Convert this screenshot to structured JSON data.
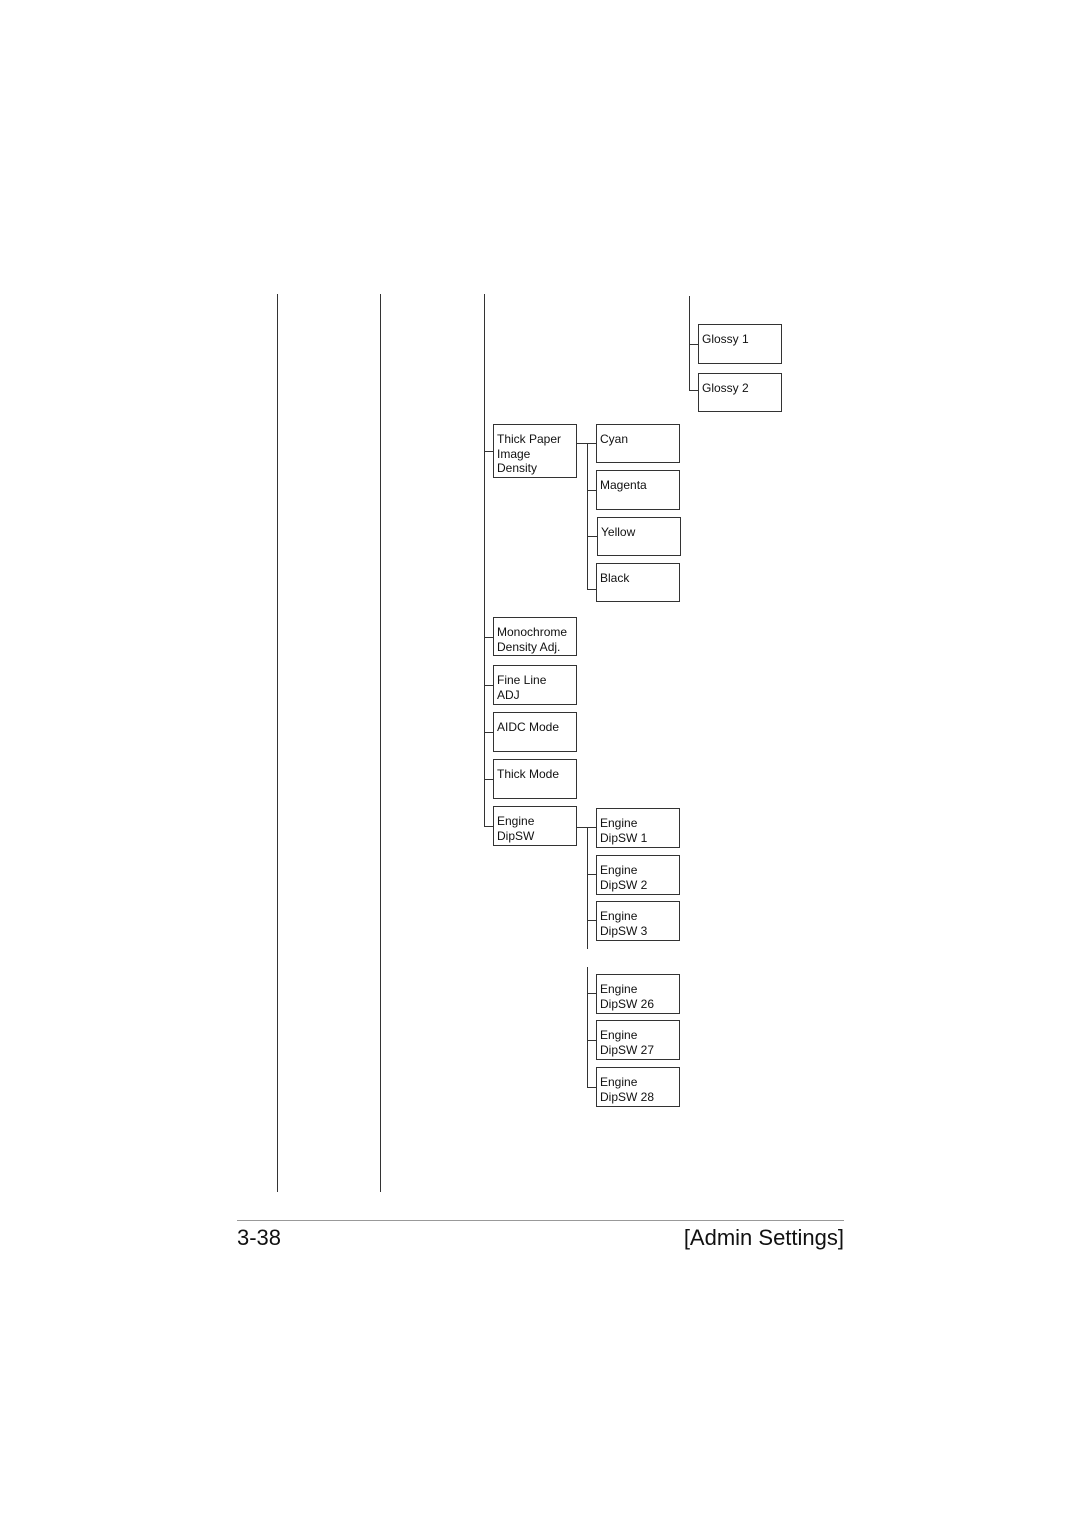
{
  "tree": {
    "glossy": [
      "Glossy 1",
      "Glossy 2"
    ],
    "level3": [
      "Thick Paper\nImage\nDensity",
      "Monochrome\nDensity Adj.",
      "Fine Line\nADJ",
      "AIDC Mode",
      "Thick Mode",
      "Engine\nDipSW"
    ],
    "colors": [
      "Cyan",
      "Magenta",
      "Yellow",
      "Black"
    ],
    "dipsw": [
      "Engine\nDipSW 1",
      "Engine\nDipSW 2",
      "Engine\nDipSW 3",
      "Engine\nDipSW 26",
      "Engine\nDipSW 27",
      "Engine\nDipSW 28"
    ]
  },
  "footer": {
    "page_number": "3-38",
    "section": "[Admin Settings]"
  }
}
